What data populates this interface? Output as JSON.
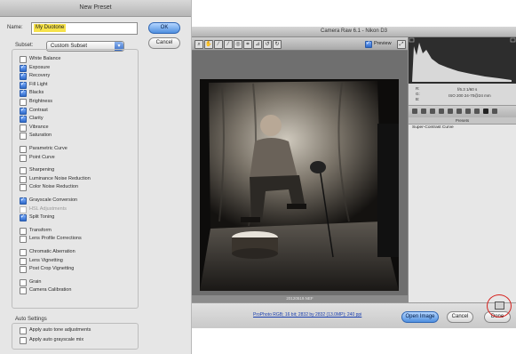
{
  "new_preset": {
    "title": "New Preset",
    "name_label": "Name:",
    "name_value": "My Duotone",
    "ok_label": "OK",
    "cancel_label": "Cancel",
    "subset_label": "Subset:",
    "subset_value": "Custom Subset",
    "options": [
      {
        "label": "White Balance",
        "checked": false
      },
      {
        "label": "Exposure",
        "checked": true
      },
      {
        "label": "Recovery",
        "checked": true
      },
      {
        "label": "Fill Light",
        "checked": true
      },
      {
        "label": "Blacks",
        "checked": true
      },
      {
        "label": "Brightness",
        "checked": false
      },
      {
        "label": "Contrast",
        "checked": true
      },
      {
        "label": "Clarity",
        "checked": true
      },
      {
        "label": "Vibrance",
        "checked": false
      },
      {
        "label": "Saturation",
        "checked": false
      },
      {
        "label": "Parametric Curve",
        "checked": false
      },
      {
        "label": "Point Curve",
        "checked": false
      },
      {
        "label": "Sharpening",
        "checked": false
      },
      {
        "label": "Luminance Noise Reduction",
        "checked": false
      },
      {
        "label": "Color Noise Reduction",
        "checked": false
      },
      {
        "label": "Grayscale Conversion",
        "checked": true
      },
      {
        "label": "HSL Adjustments",
        "checked": false,
        "disabled": true
      },
      {
        "label": "Split Toning",
        "checked": true
      },
      {
        "label": "Transform",
        "checked": false
      },
      {
        "label": "Lens Profile Corrections",
        "checked": false
      },
      {
        "label": "Chromatic Aberration",
        "checked": false
      },
      {
        "label": "Lens Vignetting",
        "checked": false
      },
      {
        "label": "Post Crop Vignetting",
        "checked": false
      },
      {
        "label": "Grain",
        "checked": false
      },
      {
        "label": "Camera Calibration",
        "checked": false
      }
    ],
    "auto_settings_label": "Auto Settings",
    "auto_options": [
      {
        "label": "Apply auto tone adjustments",
        "checked": false
      },
      {
        "label": "Apply auto grayscale mix",
        "checked": false
      }
    ]
  },
  "camera_raw": {
    "title": "Camera Raw 6.1  -  Nikon D3",
    "preview_label": "Preview",
    "filename": "20120519.NEF",
    "readout": {
      "r": "R:",
      "g": "G:",
      "b": "B:",
      "aperture_shutter": "f/6.3   1/60 s",
      "iso_lens": "ISO 200   24-70@24 mm"
    },
    "presets_tab_label": "Presets",
    "preset_item": "Super-Contrast Curve",
    "workflow_link": "ProPhoto RGB; 16 bit; 2832 by 2832 (13.0MP); 240 ppi",
    "open_image_label": "Open Image",
    "cancel_label": "Cancel",
    "done_label": "Done"
  }
}
